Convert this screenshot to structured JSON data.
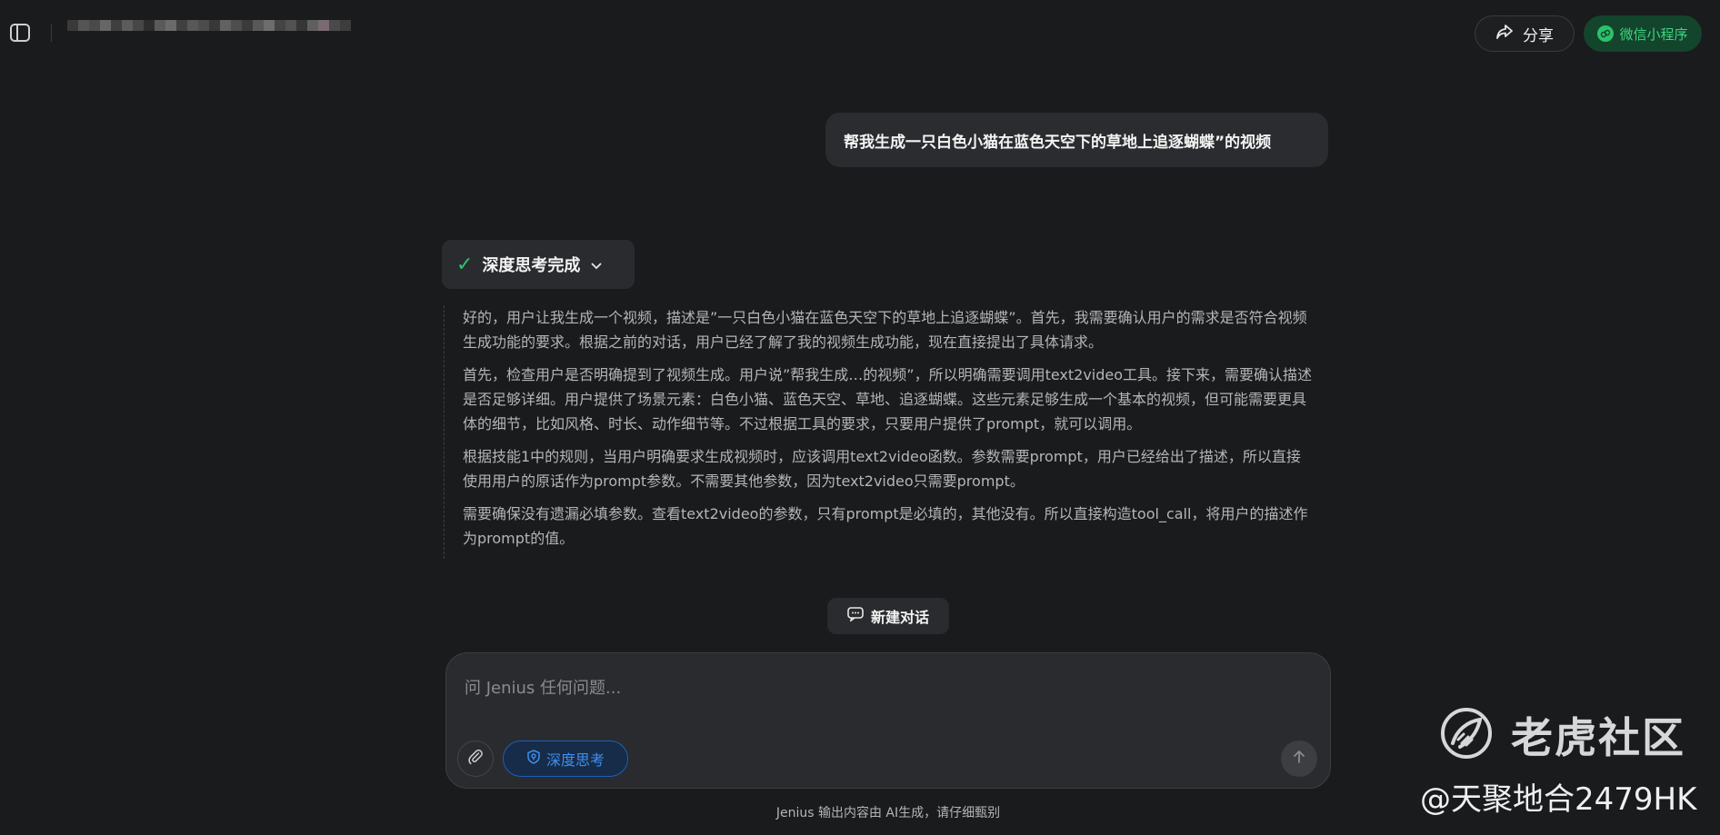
{
  "header": {
    "share_label": "分享",
    "wechat_label": "微信小程序"
  },
  "chat": {
    "user_message": "帮我生成一只白色小猫在蓝色天空下的草地上追逐蝴蝶”的视频",
    "thinking": {
      "status_label": "深度思考完成",
      "paragraphs": [
        "好的，用户让我生成一个视频，描述是”一只白色小猫在蓝色天空下的草地上追逐蝴蝶”。首先，我需要确认用户的需求是否符合视频生成功能的要求。根据之前的对话，用户已经了解了我的视频生成功能，现在直接提出了具体请求。",
        "首先，检查用户是否明确提到了视频生成。用户说”帮我生成…的视频”，所以明确需要调用text2video工具。接下来，需要确认描述是否足够详细。用户提供了场景元素：白色小猫、蓝色天空、草地、追逐蝴蝶。这些元素足够生成一个基本的视频，但可能需要更具体的细节，比如风格、时长、动作细节等。不过根据工具的要求，只要用户提供了prompt，就可以调用。",
        "根据技能1中的规则，当用户明确要求生成视频时，应该调用text2video函数。参数需要prompt，用户已经给出了描述，所以直接使用用户的原话作为prompt参数。不需要其他参数，因为text2video只需要prompt。",
        "需要确保没有遗漏必填参数。查看text2video的参数，只有prompt是必填的，其他没有。所以直接构造tool_call，将用户的描述作为prompt的值。"
      ]
    },
    "new_chat_label": "新建对话"
  },
  "composer": {
    "placeholder": "问 Jenius 任何问题...",
    "deep_think_label": "深度思考"
  },
  "footer": {
    "disclaimer": "Jenius 输出内容由 AI生成，请仔细甄别"
  },
  "watermark": {
    "brand": "老虎社区",
    "handle": "@天聚地合2479HK"
  },
  "colors": {
    "background": "#1a1b1d",
    "accent_green": "#2fc46a",
    "accent_blue": "#3d8ff0"
  }
}
